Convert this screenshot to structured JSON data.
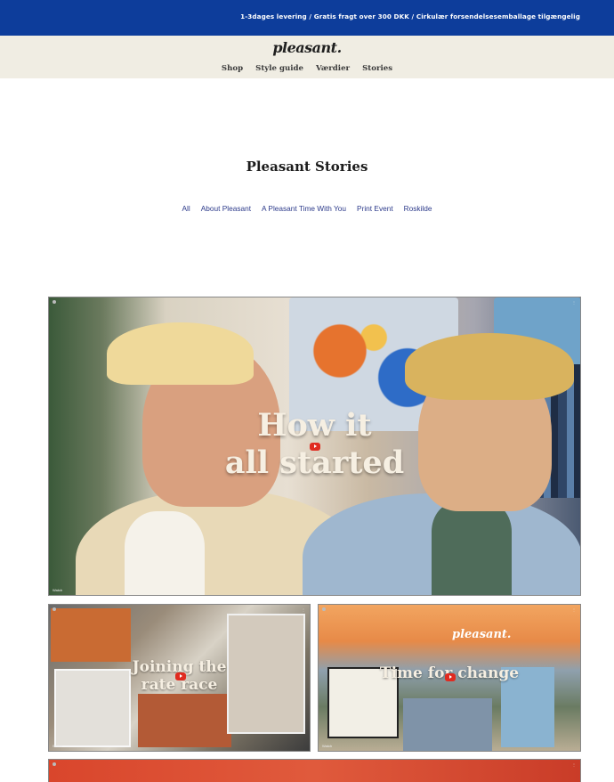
{
  "announcement": "1-3dages levering / Gratis fragt over 300 DKK / Cirkulær forsendelsesemballage tilgængelig",
  "brand": "pleasant.",
  "nav": [
    "Shop",
    "Style guide",
    "Værdier",
    "Stories"
  ],
  "page_title": "Pleasant Stories",
  "filters": [
    "All",
    "About Pleasant",
    "A Pleasant Time With You",
    "Print Event",
    "Roskilde"
  ],
  "videos": {
    "main": {
      "title_line1": "How it",
      "title_line2": "all started",
      "watch": "Watch"
    },
    "left": {
      "title_line1": "Joining the",
      "title_line2": "rate race",
      "watch": "Watch"
    },
    "right": {
      "title": "Time for change",
      "watermark": "pleasant.",
      "watch": "Watch"
    }
  },
  "colors": {
    "announcement_bar": "#0d3d9b",
    "header_bg": "#f0ede3",
    "filter_link": "#2c3a8a"
  }
}
